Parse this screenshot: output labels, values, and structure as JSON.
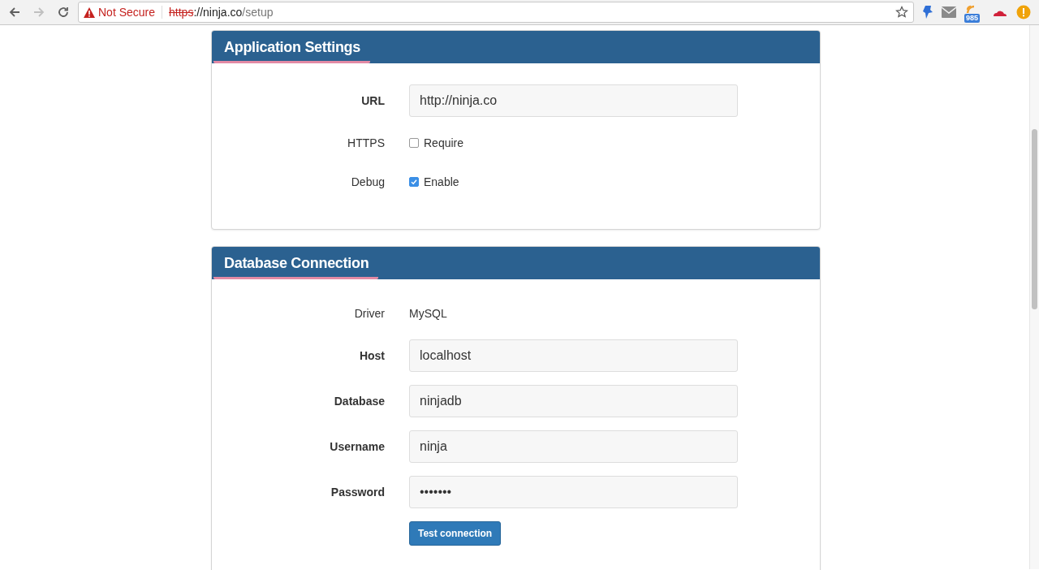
{
  "browser": {
    "security": "Not Secure",
    "url_scheme": "https",
    "url_host": "://ninja.co",
    "url_path": "/setup",
    "bookmarked": false,
    "badge": "985"
  },
  "sections": [
    {
      "title": "Application Settings",
      "fields": [
        {
          "kind": "input",
          "label": "URL",
          "value": "http://ninja.co"
        },
        {
          "kind": "checkbox",
          "label": "HTTPS",
          "option": "Require",
          "checked": false
        },
        {
          "kind": "checkbox",
          "label": "Debug",
          "option": "Enable",
          "checked": true
        }
      ]
    },
    {
      "title": "Database Connection",
      "fields": [
        {
          "kind": "text",
          "label": "Driver",
          "value": "MySQL"
        },
        {
          "kind": "input",
          "label": "Host",
          "value": "localhost"
        },
        {
          "kind": "input",
          "label": "Database",
          "value": "ninjadb"
        },
        {
          "kind": "input",
          "label": "Username",
          "value": "ninja"
        },
        {
          "kind": "input",
          "label": "Password",
          "value": "•••••••"
        },
        {
          "kind": "button",
          "label": "Test connection"
        }
      ]
    }
  ]
}
